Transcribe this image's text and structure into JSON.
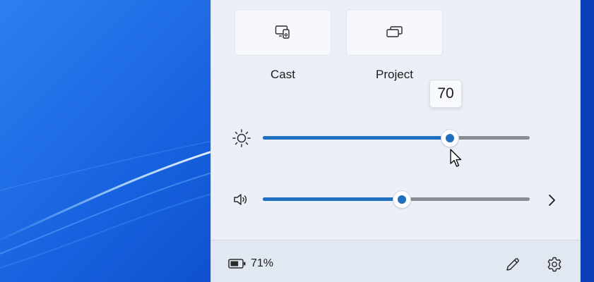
{
  "quick_actions": [
    {
      "label": "Cast",
      "icon": "cast-icon"
    },
    {
      "label": "Project",
      "icon": "project-icon"
    }
  ],
  "brightness": {
    "icon": "brightness-icon",
    "value": 70,
    "tooltip": "70"
  },
  "volume": {
    "icon": "speaker-icon",
    "value": 52,
    "chevron_icon": "chevron-right-icon"
  },
  "footer": {
    "battery_text": "71%",
    "battery_level": 71,
    "edit_icon": "pencil-icon",
    "settings_icon": "gear-icon"
  },
  "colors": {
    "accent": "#1f6ec0",
    "panel_bg": "#ebf0f8",
    "desktop": "#1763df"
  }
}
